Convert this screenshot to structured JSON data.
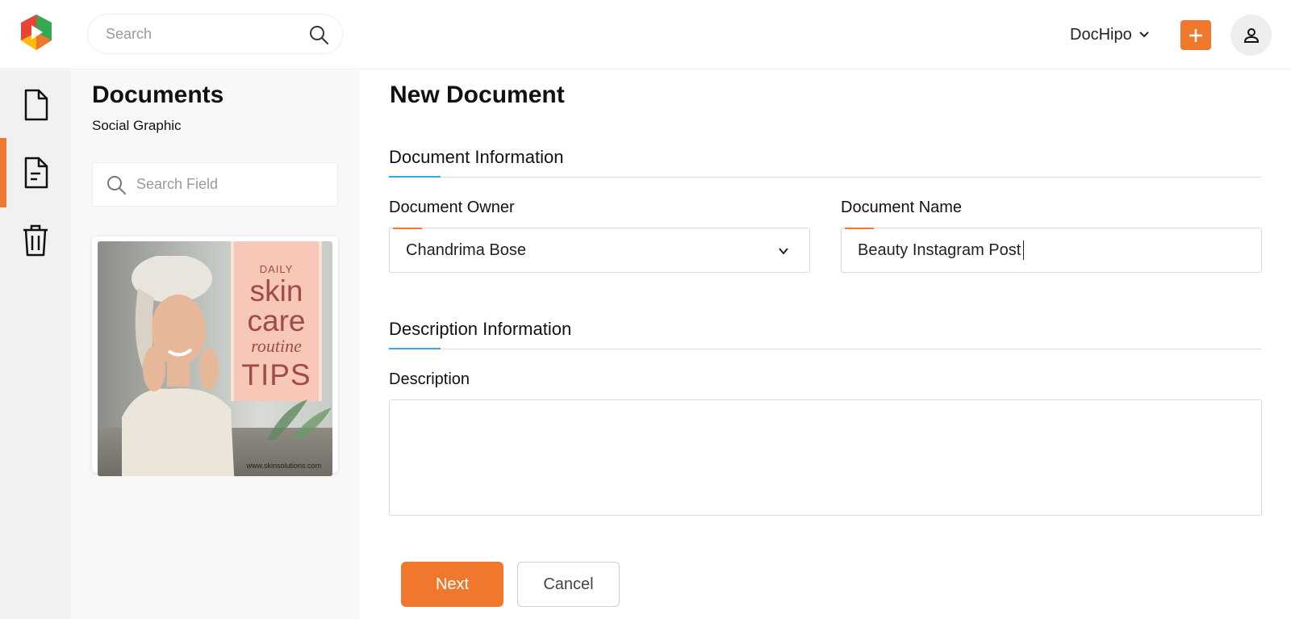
{
  "app": {
    "workspace_name": "DocHipo",
    "accent_color": "#f0782d",
    "section_accent_color": "#3aa3e3",
    "logo_icon": "dochipo-logo-icon"
  },
  "header": {
    "search_placeholder": "Search",
    "search_icon": "search-icon",
    "workspace_chevron_icon": "chevron-down-icon",
    "add_icon": "plus-icon",
    "avatar_icon": "user-icon"
  },
  "rail": {
    "items": [
      {
        "name": "documents",
        "icon": "document-icon",
        "active": false
      },
      {
        "name": "social-graphic",
        "icon": "document-text-icon",
        "active": true
      },
      {
        "name": "trash",
        "icon": "trash-icon",
        "active": false
      }
    ]
  },
  "docs_panel": {
    "title": "Documents",
    "subtitle": "Social Graphic",
    "search_placeholder": "Search Field",
    "thumbnail": {
      "line1": "DAILY",
      "line2": "skin",
      "line3": "care",
      "line4": "routine",
      "line5": "TIPS",
      "url": "www.skinsolutions.com"
    }
  },
  "form": {
    "page_title": "New Document",
    "doc_info_section": "Document Information",
    "owner_label": "Document Owner",
    "owner_value": "Chandrima Bose",
    "name_label": "Document Name",
    "name_value": "Beauty Instagram Post",
    "desc_info_section": "Description Information",
    "description_label": "Description",
    "description_value": "",
    "next_label": "Next",
    "cancel_label": "Cancel"
  }
}
